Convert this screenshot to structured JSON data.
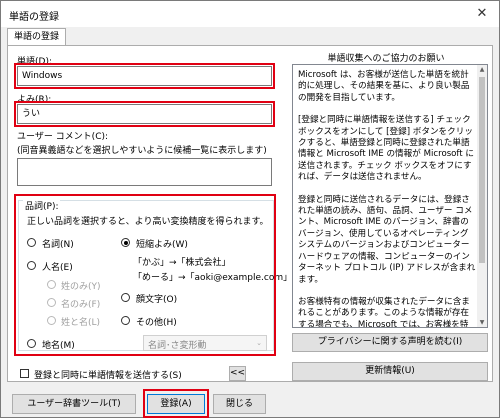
{
  "window": {
    "title": "単語の登録",
    "close_glyph": "✕"
  },
  "tab": {
    "label": "単語の登録"
  },
  "word": {
    "label": "単語(D):",
    "value": "Windows"
  },
  "reading": {
    "label": "よみ(R):",
    "value": "うい"
  },
  "comment": {
    "label": "ユーザー コメント(C):",
    "hint": "(同音異義語などを選択しやすいように候補一覧に表示します)",
    "value": ""
  },
  "pos": {
    "label": "品詞(P):",
    "instruction": "正しい品詞を選択すると、より高い変換精度を得られます。",
    "options": {
      "noun": "名詞(N)",
      "person": "人名(E)",
      "given_surname": "姓のみ(Y)",
      "given_name": "名のみ(F)",
      "full_name": "姓と名(L)",
      "place": "地名(M)",
      "short": "短縮よみ(W)",
      "emoticon": "顔文字(O)",
      "other": "その他(H)"
    },
    "short_example1": "「かぶ」→「株式会社」",
    "short_example2": "「めーる」→「aoki@example.com」",
    "select_value": "名詞･さ変形動",
    "select_arrow": "⌄"
  },
  "send": {
    "label": "登録と同時に単語情報を送信する(S)",
    "collapse_label": "<<"
  },
  "notice": {
    "title": "単語収集へのご協力のお願い",
    "paragraphs": [
      "Microsoft は、お客様が送信した単語を統計的に処理し、その結果を基に、より良い製品の開発を目指しています。",
      "[登録と同時に単語情報を送信する] チェック ボックスをオンにして [登録] ボタンをクリックすると、単語登録と同時に登録された単語情報と Microsoft IME の情報が Microsoft に送信されます。チェック ボックスをオフにすれば、データは送信されません。",
      "登録と同時に送信されるデータには、登録された単語の読み、語句、品詞、ユーザー コメント、Microsoft IME のバージョン、辞書のバージョン、使用しているオペレーティング システムのバージョンおよびコンピューター ハードウェアの情報、コンピューターのインターネット プロトコル (IP) アドレスが含まれます。",
      "お客様特有の情報が収集されたデータに含まれることがあります。このような情報が存在する場合でも、Microsoft では、お客様を特定するために使用することはありません。"
    ],
    "scroll_up": "▲",
    "scroll_down": "▼"
  },
  "buttons": {
    "privacy": "プライバシーに関する声明を読む(I)",
    "update": "更新情報(U)",
    "user_dict": "ユーザー辞書ツール(T)",
    "register": "登録(A)",
    "close": "閉じる"
  },
  "colors": {
    "highlight": "#e00012",
    "focus": "#0078d7"
  }
}
